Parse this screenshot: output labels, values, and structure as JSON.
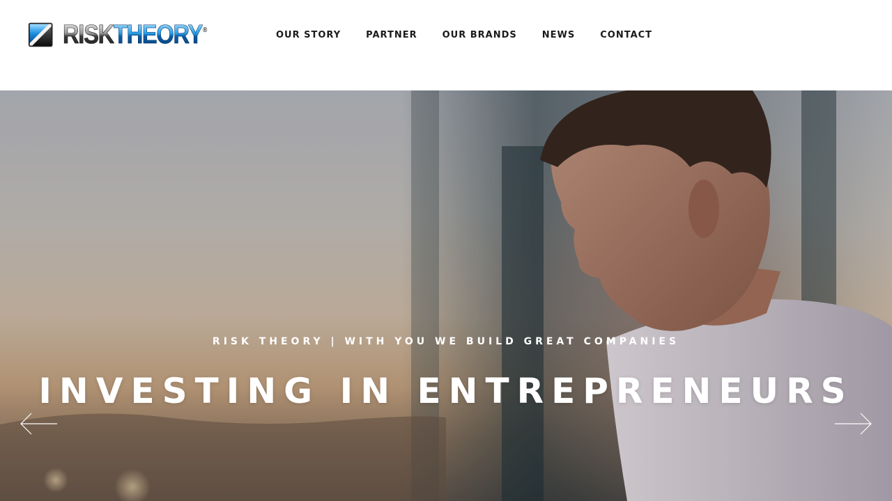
{
  "brand": {
    "logo_part1": "RISK",
    "logo_part2": "THEORY",
    "logo_registered": "®",
    "colors": {
      "logo_blue": "#0a5fa8",
      "logo_dark": "#1a1a1a"
    }
  },
  "nav": {
    "items": [
      {
        "label": "OUR STORY"
      },
      {
        "label": "PARTNER"
      },
      {
        "label": "OUR BRANDS"
      },
      {
        "label": "NEWS"
      },
      {
        "label": "CONTACT"
      }
    ]
  },
  "hero": {
    "subtitle": "RISK THEORY | WITH YOU WE BUILD GREAT COMPANIES",
    "title": "INVESTING IN ENTREPRENEURS",
    "prev_icon": "arrow-left-icon",
    "next_icon": "arrow-right-icon"
  }
}
